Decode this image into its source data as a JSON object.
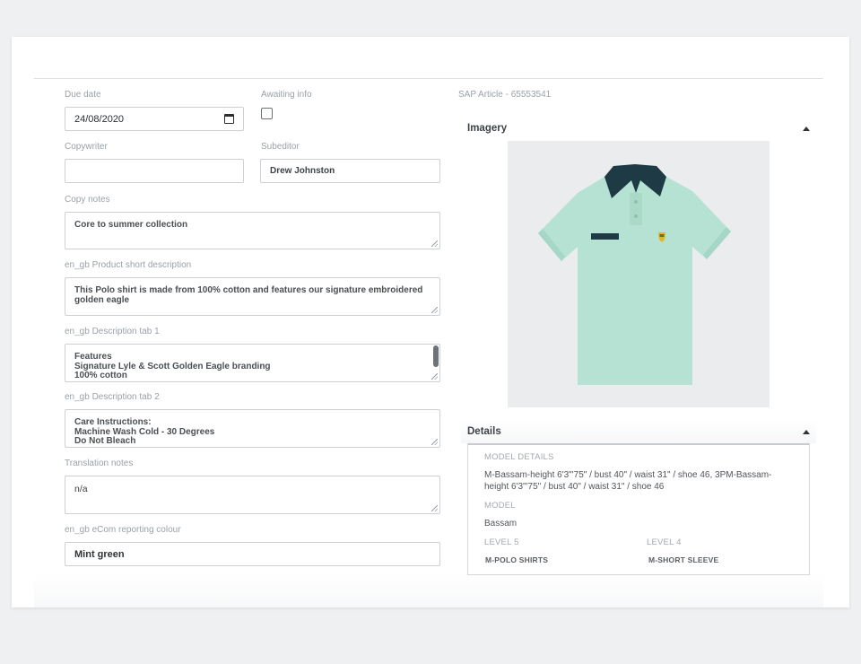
{
  "form": {
    "due_date": {
      "label": "Due date",
      "value": "24/08/2020"
    },
    "awaiting_info": {
      "label": "Awaiting info",
      "checked": false
    },
    "copywriter": {
      "label": "Copywriter",
      "value": ""
    },
    "subeditor": {
      "label": "Subeditor",
      "value": "Drew Johnston"
    },
    "copy_notes": {
      "label": "Copy notes",
      "lines": [
        "Core to summer collection"
      ]
    },
    "short_description": {
      "label": "en_gb Product short description",
      "lines": [
        "This Polo shirt is made from 100% cotton and features our signature embroidered",
        "golden eagle"
      ]
    },
    "description_tab_1": {
      "label": "en_gb Description tab 1",
      "lines": [
        "Features",
        "Signature Lyle & Scott Golden Eagle branding",
        "100% cotton"
      ]
    },
    "description_tab_2": {
      "label": "en_gb Description tab 2",
      "lines": [
        "Care Instructions:",
        "Machine Wash Cold - 30 Degrees",
        "Do Not Bleach"
      ]
    },
    "translation_notes": {
      "label": "Translation notes",
      "lines": [
        "n/a"
      ]
    },
    "reporting_colour": {
      "label": "en_gb eCom reporting colour",
      "value": "Mint green"
    }
  },
  "sidebar": {
    "sap_article": "SAP Article - 65553541",
    "imagery": {
      "title": "Imagery",
      "product_colour": "#b5e2d2",
      "collar_colour": "#1e3a44"
    },
    "details": {
      "title": "Details",
      "model_details_label": "MODEL DETAILS",
      "model_details_lines": [
        "M-Bassam-height 6'3\"'75\" / bust 40\" / waist 31\" / shoe 46, 3PM-Bassam-",
        "height 6'3\"'75\" / bust 40\" / waist 31\" / shoe 46"
      ],
      "model_label": "MODEL",
      "model_value": "Bassam",
      "level5_label": "LEVEL 5",
      "level5_value": "M-POLO SHIRTS",
      "level4_label": "LEVEL 4",
      "level4_value": "M-SHORT SLEEVE"
    }
  }
}
